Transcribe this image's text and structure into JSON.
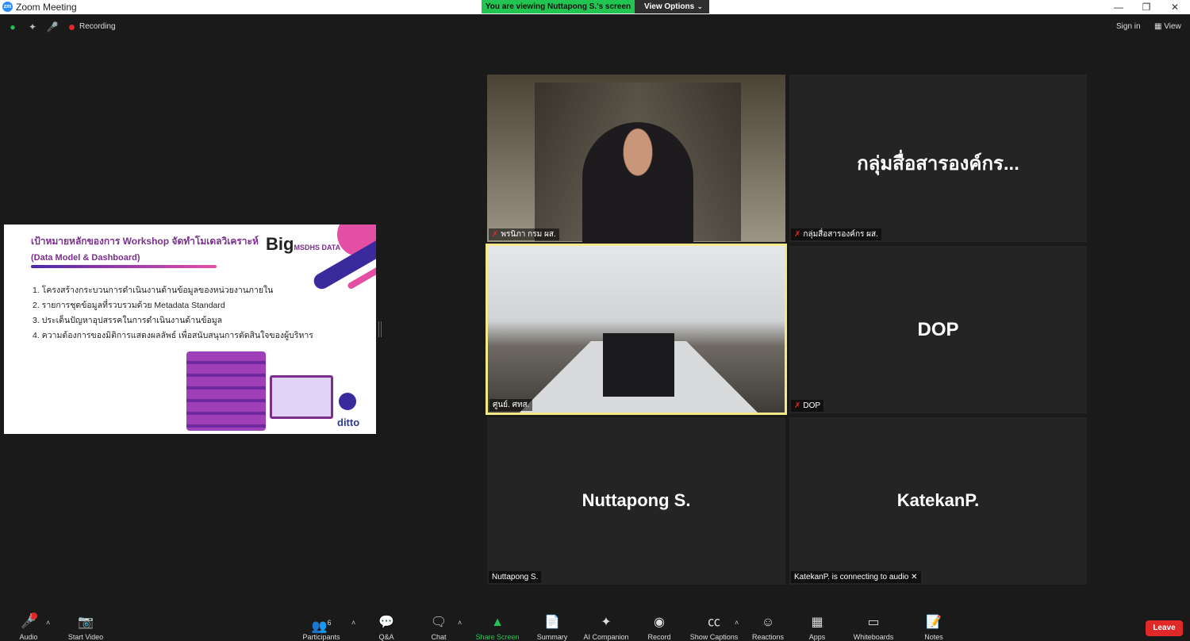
{
  "window": {
    "app_title": "Zoom Meeting"
  },
  "banner": {
    "viewing_text": "You are viewing Nuttapong S.'s screen",
    "view_options_label": "View Options"
  },
  "statusbar": {
    "recording_label": "Recording",
    "signin_label": "Sign in",
    "view_label": "View"
  },
  "shared_slide": {
    "heading": "เป้าหมายหลักของการ Workshop จัดทำโมเดลวิเคราะห์",
    "subheading": "(Data Model & Dashboard)",
    "logo_big": "Big",
    "logo_small": "MSDHS DATA",
    "items": [
      "1. โครงสร้างกระบวนการดำเนินงานด้านข้อมูลของหน่วยงานภายใน",
      "2. รายการชุดข้อมูลที่รวบรวมด้วย Metadata Standard",
      "3. ประเด็นปัญหาอุปสรรคในการดำเนินงานด้านข้อมูล",
      "4. ความต้องการของมิติการแสดงผลลัพธ์ เพื่อสนับสนุนการตัดสินใจของผู้บริหาร"
    ],
    "brand": "ditto"
  },
  "tiles": [
    {
      "label": "พรนิภา กรม ผส.",
      "big_name": ""
    },
    {
      "label": "กลุ่มสื่อสารองค์กร ผส.",
      "big_name": "กลุ่มสื่อสารองค์กร..."
    },
    {
      "label": "ศูนย์. ศทส.",
      "big_name": ""
    },
    {
      "label": "DOP",
      "big_name": "DOP"
    },
    {
      "label": "Nuttapong S.",
      "big_name": "Nuttapong S."
    },
    {
      "label": "KatekanP. is connecting to audio",
      "big_name": "KatekanP."
    }
  ],
  "toolbar": {
    "audio": "Audio",
    "start_video": "Start Video",
    "participants": "Participants",
    "participants_count": "6",
    "qa": "Q&A",
    "chat": "Chat",
    "share_screen": "Share Screen",
    "summary": "Summary",
    "ai_companion": "AI Companion",
    "record": "Record",
    "show_captions": "Show Captions",
    "reactions": "Reactions",
    "apps": "Apps",
    "whiteboards": "Whiteboards",
    "notes": "Notes",
    "leave": "Leave"
  },
  "colors": {
    "accent_green": "#23c552",
    "leave_red": "#e02828",
    "active_speaker": "#f2e98b"
  }
}
